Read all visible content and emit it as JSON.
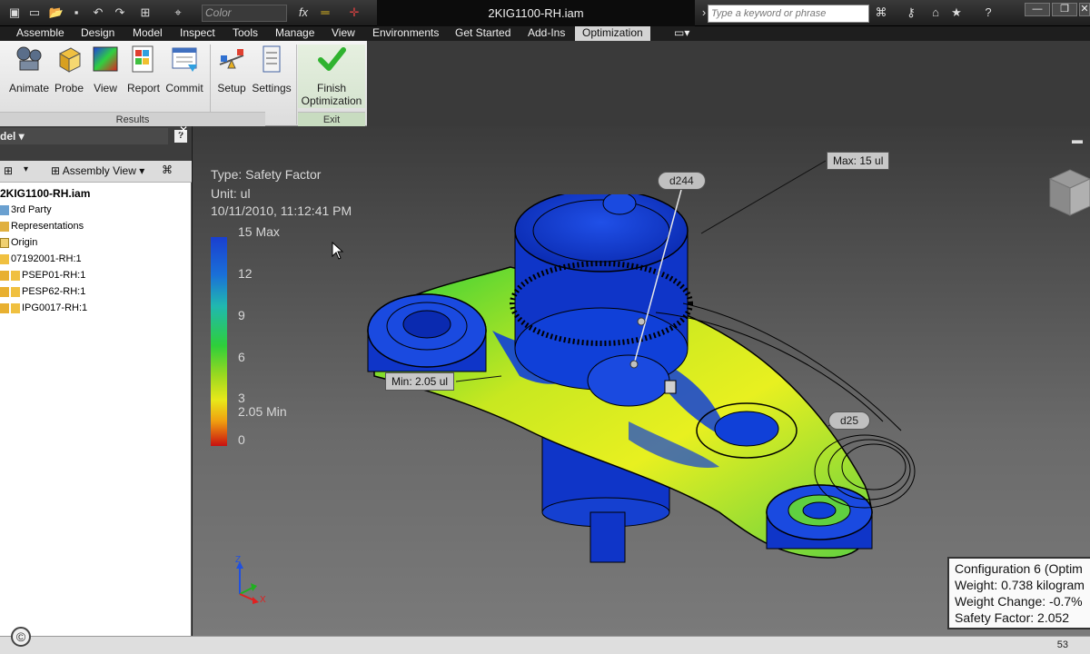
{
  "qat": {
    "color_placeholder": "Color",
    "fx_label": "fx",
    "document_title": "2KIG1100-RH.iam",
    "search_placeholder": "Type a keyword or phrase"
  },
  "menu": {
    "items": [
      "Assemble",
      "Design",
      "Model",
      "Inspect",
      "Tools",
      "Manage",
      "View",
      "Environments",
      "Get Started",
      "Add-Ins",
      "Optimization"
    ],
    "active": "Optimization"
  },
  "ribbon": {
    "results_buttons": [
      "Animate",
      "Probe",
      "View",
      "Report",
      "Commit"
    ],
    "setup_buttons": [
      "Setup",
      "Settings"
    ],
    "finish_line1": "Finish",
    "finish_line2": "Optimization",
    "results_panel": "Results",
    "exit_panel": "Exit"
  },
  "browser": {
    "title": "del",
    "help": "?",
    "assembly_view": "Assembly View",
    "root": "2KIG1100-RH.iam",
    "items": [
      "3rd Party",
      "Representations",
      "Origin",
      "07192001-RH:1",
      "PSEP01-RH:1",
      "PESP62-RH:1",
      "IPG0017-RH:1"
    ]
  },
  "viewport": {
    "type_line": "Type: Safety Factor",
    "unit_line": "Unit: ul",
    "timestamp": "10/11/2010, 11:12:41 PM",
    "legend_labels": [
      "15 Max",
      "12",
      "9",
      "6",
      "3",
      "2.05 Min",
      "0"
    ],
    "max_callout": "Max: 15 ul",
    "min_callout": "Min: 2.05 ul",
    "dim_pill_1": "d244",
    "dim_pill_2": "d25",
    "triad_z": "Z",
    "triad_x": "X",
    "config": {
      "line1": "Configuration 6 (Optim",
      "line2": "Weight: 0.738 kilogram",
      "line3": "Weight Change: -0.7%",
      "line4": "Safety Factor: 2.052"
    }
  },
  "status": {
    "page_number": "53",
    "copyright_icon": "copyright-icon"
  },
  "colors": {
    "legend_top": "#1a3fd0",
    "legend_mid": "#2ecf3a",
    "legend_low": "#e8e81a",
    "legend_bottom": "#c81010",
    "accent_check": "#2fb32f"
  }
}
